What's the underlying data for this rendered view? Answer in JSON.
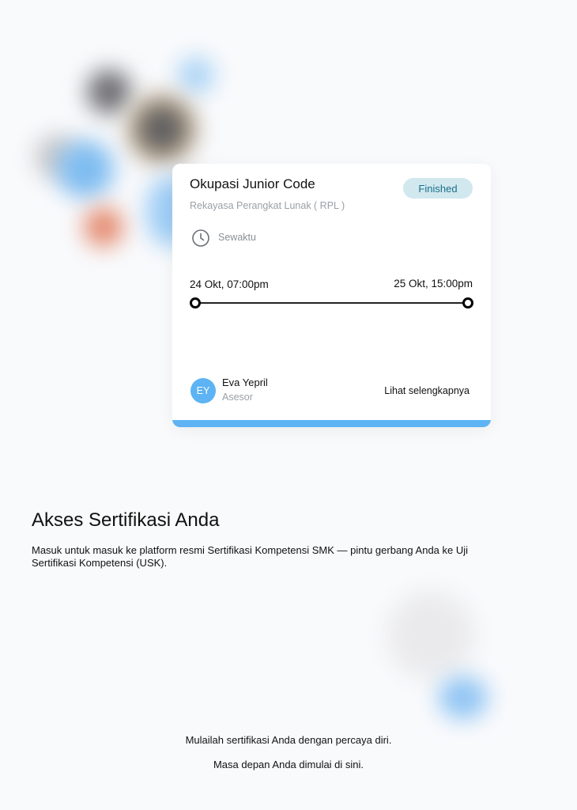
{
  "card": {
    "title": "Okupasi Junior Code",
    "status": "Finished",
    "subtitle": "Rekayasa Perangkat Lunak ( RPL )",
    "time_icon": "clock-icon",
    "time_label": "Sewaktu",
    "start_date": "24 Okt, 07:00pm",
    "end_date": "25 Okt, 15:00pm",
    "assessor": {
      "initials": "EY",
      "name": "Eva Yepril",
      "role": "Asesor"
    },
    "detail_link": "Lihat selengkapnya"
  },
  "main": {
    "heading": "Akses Sertifikasi Anda",
    "description": "Masuk untuk masuk ke platform resmi Sertifikasi Kompetensi SMK — pintu gerbang Anda ke Uji Sertifikasi Kompetensi (USK).",
    "tagline_1": "Mulailah sertifikasi Anda dengan percaya diri.",
    "tagline_2": "Masa depan Anda dimulai di sini."
  },
  "colors": {
    "accent": "#5db3f3",
    "badge_bg": "#d1e8ef",
    "badge_text": "#1b6f8a",
    "background": "#f9fafc"
  }
}
